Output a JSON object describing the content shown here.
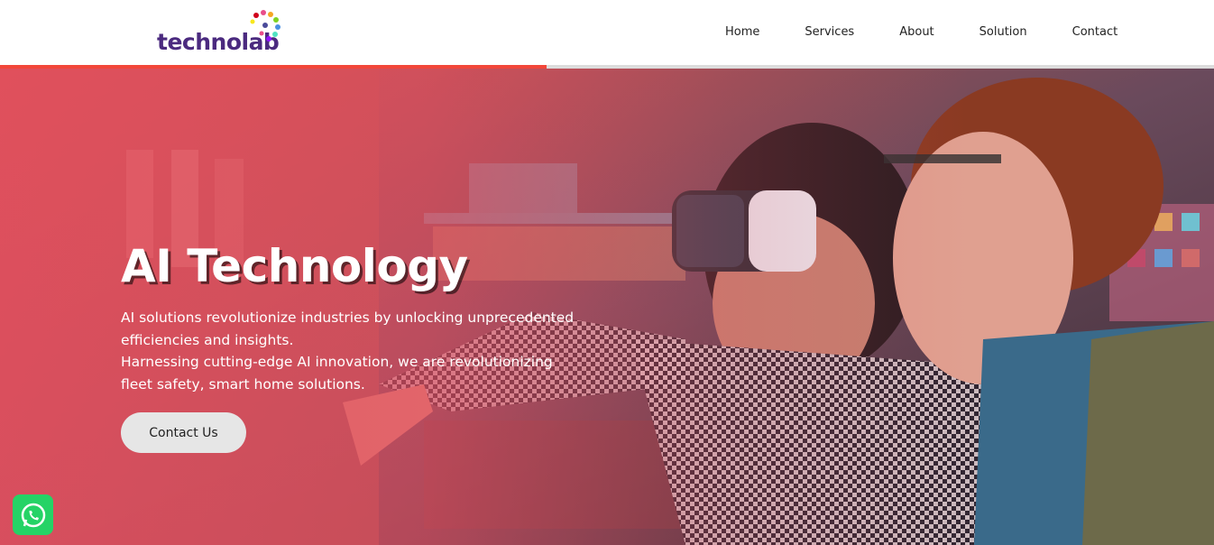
{
  "header": {
    "logo_text": "technolab",
    "nav": [
      {
        "label": "Home"
      },
      {
        "label": "Services"
      },
      {
        "label": "About"
      },
      {
        "label": "Solution"
      },
      {
        "label": "Contact"
      }
    ]
  },
  "scroll_progress": 0.45,
  "hero": {
    "title": "AI Technology",
    "description_lines": [
      "AI solutions revolutionize industries by unlocking unprecedented",
      "efficiencies and insights.",
      "Harnessing cutting-edge AI innovation, we are revolutionizing",
      "fleet safety, smart home solutions."
    ],
    "cta_label": "Contact Us",
    "background_image": "two people using VR headset in a workshop"
  },
  "floating": {
    "whatsapp_icon": "whatsapp-icon"
  },
  "colors": {
    "brand": "#4b2a7f",
    "accent": "#f2473a",
    "whatsapp": "#25d366"
  }
}
